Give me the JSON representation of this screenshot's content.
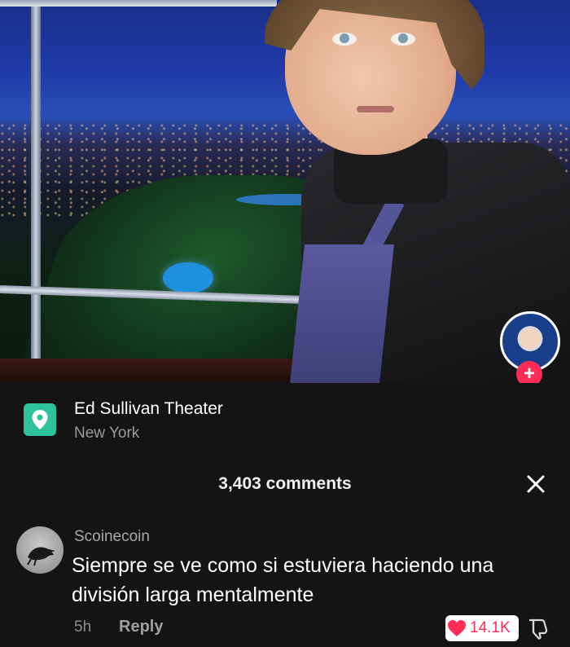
{
  "location": {
    "name": "Ed Sullivan Theater",
    "city": "New York",
    "icon": "map-pin-icon",
    "accent": "#2ec39a"
  },
  "comments_header": {
    "count_label": "3,403 comments",
    "close_icon": "close-icon"
  },
  "comment": {
    "username": "Scoinecoin",
    "text": "Siempre se ve como si estuviera haciendo una división larga mentalmente",
    "time": "5h",
    "reply_label": "Reply",
    "like_count": "14.1K",
    "like_color": "#ff2c55"
  },
  "creator": {
    "follow_symbol": "+"
  }
}
